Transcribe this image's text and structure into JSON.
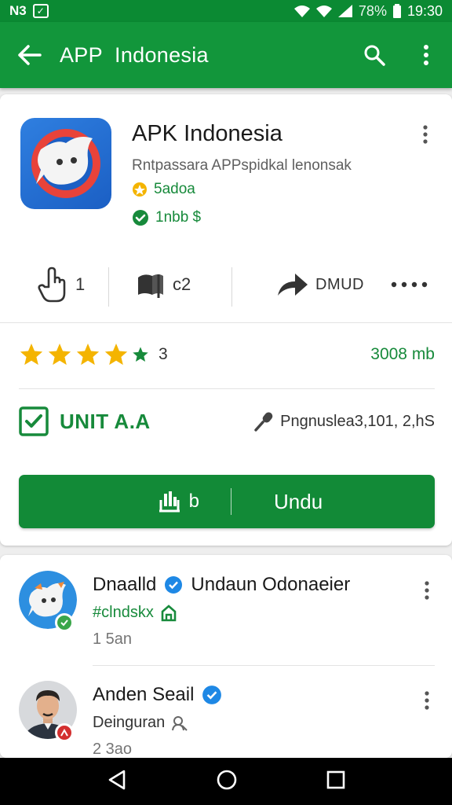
{
  "status_bar": {
    "left_text": "N3",
    "battery": "78%",
    "time": "19:30"
  },
  "app_bar": {
    "title": "APP  Indonesia"
  },
  "app": {
    "name": "APK Indonesia",
    "description": "Rntpassara APPspidkal lenonsak",
    "meta1": "5adoa",
    "meta2": "1nbb $"
  },
  "actions": {
    "like_count": "1",
    "flag_count": "c2",
    "share_label": "DMUD"
  },
  "rating": {
    "stars": 4,
    "value": "3",
    "size": "3008 mb"
  },
  "install": {
    "status": "UNIT A.A",
    "downloads": "Pngnuslea3,101, 2,hS"
  },
  "download_button": {
    "left_label": "b",
    "label": "Undu"
  },
  "reviews": [
    {
      "name": "Dnaalld",
      "title": "Undaun Odonaeier",
      "sub": "#clndskx",
      "time": "1 5an"
    },
    {
      "name": "Anden Seail",
      "sub": "Deinguran",
      "time": "2 3ao"
    }
  ],
  "colors": {
    "brand_green": "#12963b",
    "text_green": "#178a3b",
    "star": "#f4b400",
    "verified_blue": "#1e88e5"
  }
}
